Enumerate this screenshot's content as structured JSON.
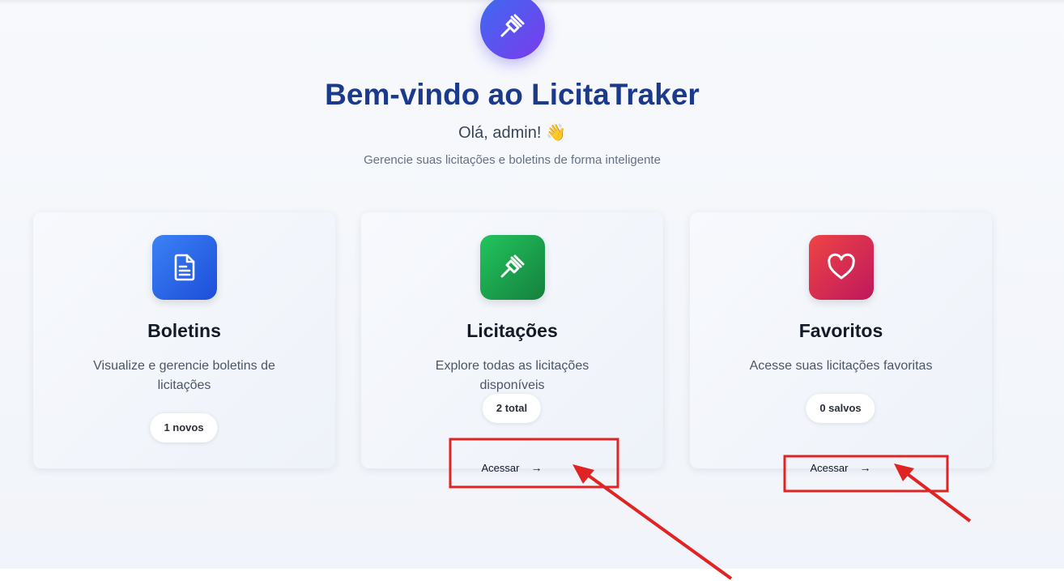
{
  "hero": {
    "logo_icon": "gavel-icon",
    "title": "Bem-vindo ao LicitaTraker",
    "greeting": "Olá, admin! 👋",
    "subtitle": "Gerencie suas licitações e boletins de forma inteligente"
  },
  "cards": [
    {
      "title": "Boletins",
      "description": "Visualize e gerencie boletins de licitações",
      "badge": "1 novos",
      "icon": "document-icon",
      "icon_colors": [
        "#3b82f6",
        "#1d4ed8"
      ]
    },
    {
      "title": "Licitações",
      "description": "Explore todas as licitações disponíveis",
      "badge": "2 total",
      "link_label": "Acessar",
      "link_arrow": "→",
      "icon": "gavel-icon",
      "icon_colors": [
        "#22c55e",
        "#15803d"
      ]
    },
    {
      "title": "Favoritos",
      "description": "Acesse suas licitações favoritas",
      "badge": "0 salvos",
      "link_label": "Acessar",
      "link_arrow": "→",
      "icon": "heart-icon",
      "icon_colors": [
        "#ef4444",
        "#be185d"
      ]
    }
  ],
  "annotation_color": "#e02424"
}
